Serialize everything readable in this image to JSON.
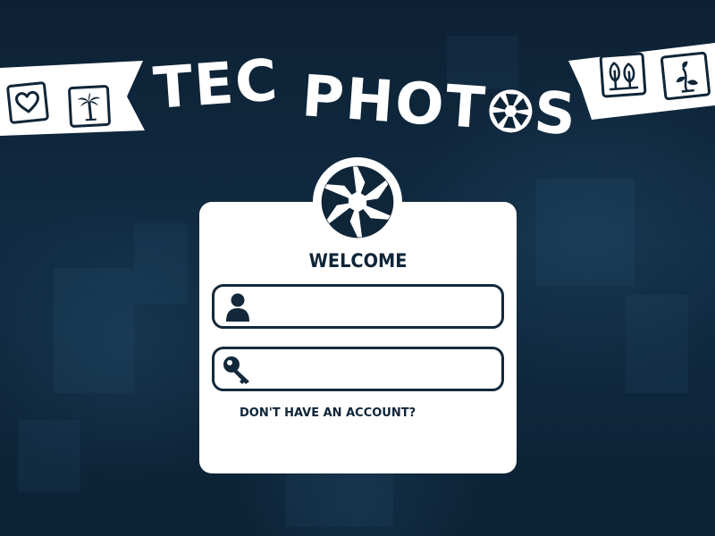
{
  "header": {
    "title_part1": "TEC",
    "title_part2_prefix": "PHOT",
    "title_part2_suffix": "S",
    "left_icons": [
      "heart-icon",
      "palm-tree-icon"
    ],
    "right_icons": [
      "trees-icon",
      "plant-icon"
    ]
  },
  "login": {
    "logo_icon": "camera-aperture-icon",
    "welcome": "WELCOME",
    "username": {
      "icon": "user-icon",
      "value": "",
      "placeholder": ""
    },
    "password": {
      "icon": "key-icon",
      "value": "",
      "placeholder": ""
    },
    "signup_link": "DON'T HAVE AN ACCOUNT?"
  },
  "colors": {
    "background": "#0d2438",
    "navy": "#0f2538",
    "white": "#ffffff"
  }
}
